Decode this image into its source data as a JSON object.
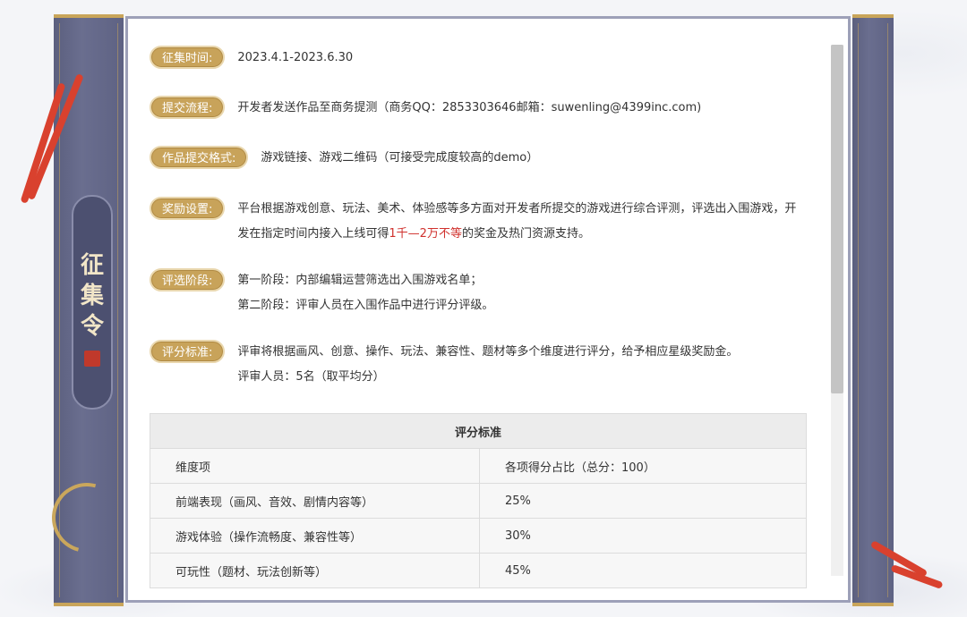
{
  "banner": {
    "chars": [
      "征",
      "集",
      "令"
    ]
  },
  "rows": [
    {
      "tag": "征集时间:",
      "lines": [
        "2023.4.1-2023.6.30"
      ]
    },
    {
      "tag": "提交流程:",
      "lines": [
        "开发者发送作品至商务提测（商务QQ：2853303646邮箱：suwenling@4399inc.com)"
      ]
    },
    {
      "tag": "作品提交格式:",
      "lines": [
        "游戏链接、游戏二维码（可接受完成度较高的demo）"
      ]
    },
    {
      "tag": "奖励设置:",
      "line1": "平台根据游戏创意、玩法、美术、体验感等多方面对开发者所提交的游戏进行综合评测，评选出入围游戏，开",
      "line2_pre": "发在指定时间内接入上线可得",
      "line2_highlight": "1千—2万不等",
      "line2_post": "的奖金及热门资源支持。"
    },
    {
      "tag": "评选阶段:",
      "lines": [
        "第一阶段：内部编辑运营筛选出入围游戏名单；",
        "第二阶段：评审人员在入围作品中进行评分评级。"
      ]
    },
    {
      "tag": "评分标准:",
      "lines": [
        "评审将根据画风、创意、操作、玩法、兼容性、题材等多个维度进行评分，给予相应星级奖励金。",
        "评审人员：5名（取平均分）"
      ]
    }
  ],
  "table": {
    "title": "评分标准",
    "rows": [
      [
        "维度项",
        "各项得分占比（总分：100）"
      ],
      [
        "前端表现（画风、音效、剧情内容等）",
        "25%"
      ],
      [
        "游戏体验（操作流畅度、兼容性等）",
        "30%"
      ],
      [
        "可玩性（题材、玩法创新等）",
        "45%"
      ]
    ]
  },
  "colors": {
    "tag_gold": "#c8a35a",
    "roller": "#5b5f7e",
    "highlight": "#d0312d"
  }
}
